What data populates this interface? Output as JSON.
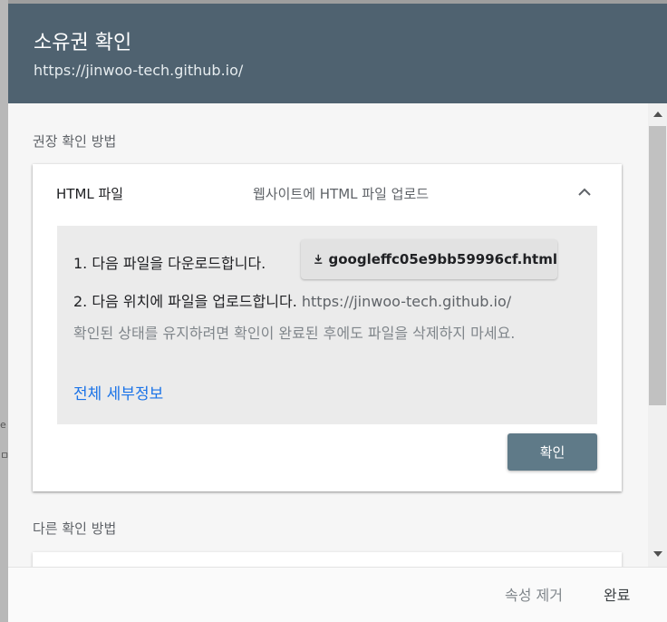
{
  "dialog": {
    "title": "소유권 확인",
    "property_url": "https://jinwoo-tech.github.io/"
  },
  "recommended": {
    "section_label": "권장 확인 방법",
    "method": {
      "title": "HTML 파일",
      "description": "웹사이트에 HTML 파일 업로드",
      "expand_icon": "chevron-up-icon",
      "step1": "1. 다음 파일을 다운로드합니다.",
      "download_icon": "download-icon",
      "download_filename": "googleffc05e9bb59996cf.html",
      "step2_text": "2. 다음 위치에 파일을 업로드합니다.",
      "step2_url": "https://jinwoo-tech.github.io/",
      "note": "확인된 상태를 유지하려면 확인이 완료된 후에도 파일을 삭제하지 마세요.",
      "details_link": "전체 세부정보",
      "confirm_label": "확인"
    }
  },
  "other": {
    "section_label": "다른 확인 방법"
  },
  "footer": {
    "remove_label": "속성 제거",
    "done_label": "완료"
  },
  "colors": {
    "header_bg": "#4f6270",
    "confirm_bg": "#5f7a88",
    "link": "#1a73e8"
  }
}
